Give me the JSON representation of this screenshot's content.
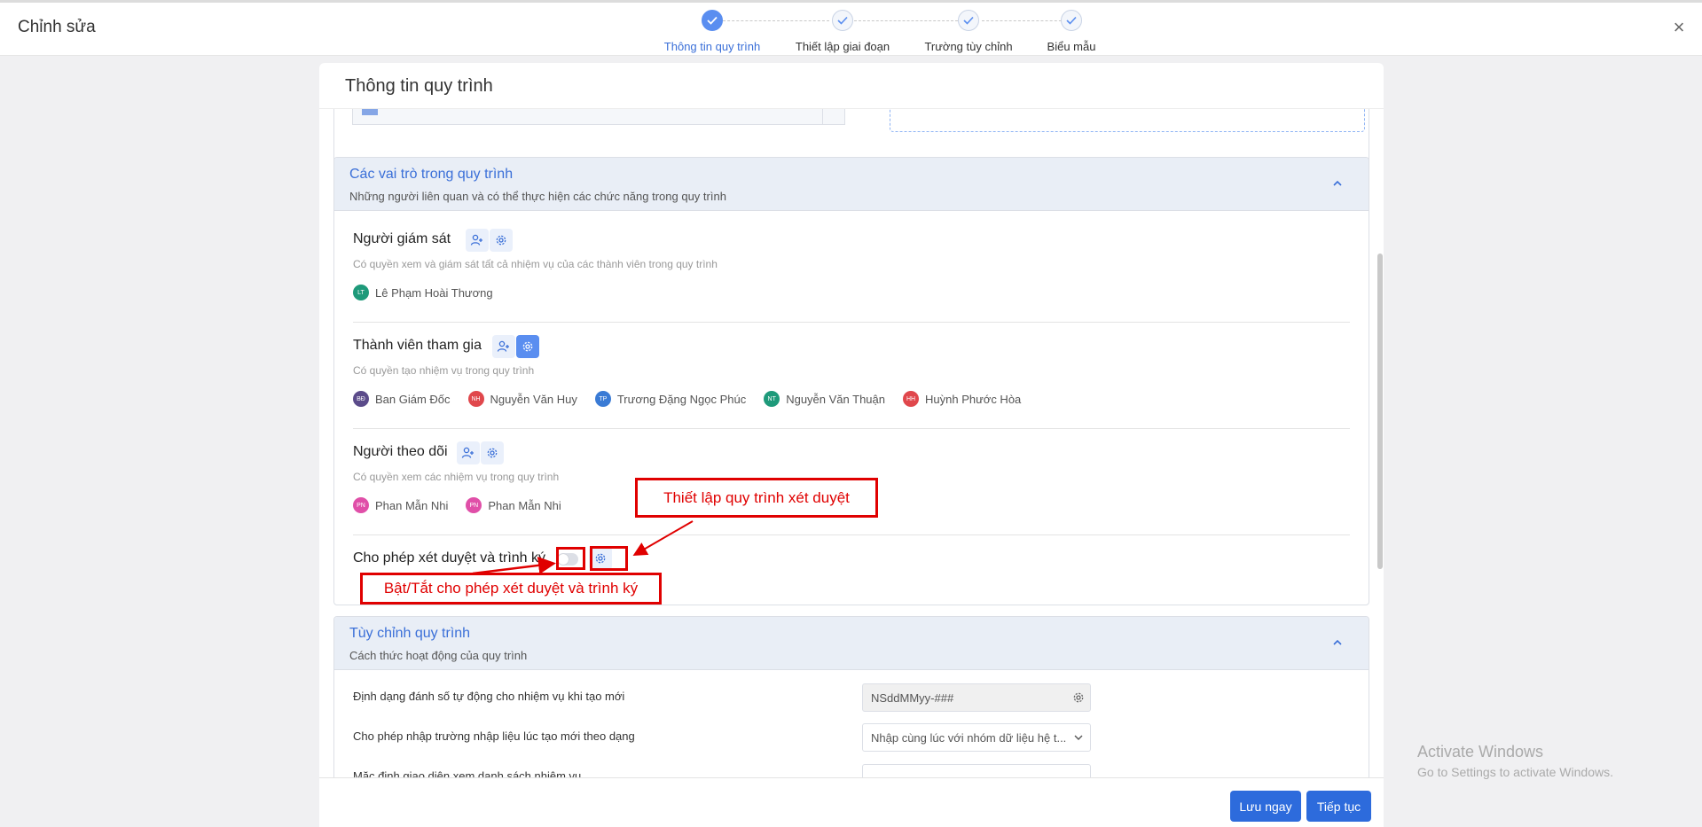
{
  "header": {
    "title": "Chỉnh sửa",
    "close": "×",
    "steps": [
      {
        "label": "Thông tin quy trình",
        "active": true
      },
      {
        "label": "Thiết lập giai đoạn",
        "active": false
      },
      {
        "label": "Trường tùy chỉnh",
        "active": false
      },
      {
        "label": "Biểu mẫu",
        "active": false
      }
    ]
  },
  "panel": {
    "title": "Thông tin quy trình"
  },
  "roles_section": {
    "title": "Các vai trò trong quy trình",
    "description": "Những người liên quan và có thể thực hiện các chức năng trong quy trình",
    "supervisor": {
      "name": "Người giám sát",
      "desc": "Có quyền xem và giám sát tất cả nhiệm vụ của các thành viên trong quy trình",
      "members": [
        {
          "initials": "LT",
          "name": "Lê Phạm Hoài Thương",
          "color": "#1e9a7a"
        }
      ]
    },
    "participants": {
      "name": "Thành viên tham gia",
      "desc": "Có quyền tạo nhiệm vụ trong quy trình",
      "members": [
        {
          "initials": "BĐ",
          "name": "Ban Giám Đốc",
          "color": "#5b4b8a"
        },
        {
          "initials": "NH",
          "name": "Nguyễn Văn Huy",
          "color": "#e0474c"
        },
        {
          "initials": "TP",
          "name": "Trương Đặng Ngọc Phúc",
          "color": "#3a7bd5"
        },
        {
          "initials": "NT",
          "name": "Nguyễn Văn Thuận",
          "color": "#1e9a7a"
        },
        {
          "initials": "HH",
          "name": "Huỳnh Phước Hòa",
          "color": "#e0474c"
        }
      ]
    },
    "followers": {
      "name": "Người theo dõi",
      "desc": "Có quyền xem các nhiệm vụ trong quy trình",
      "members": [
        {
          "initials": "PN",
          "name": "Phan Mẫn Nhi",
          "color": "#e04fa8"
        },
        {
          "initials": "PN",
          "name": "Phan Mẫn Nhi",
          "color": "#e04fa8"
        }
      ]
    },
    "approval": {
      "name": "Cho phép xét duyệt và trình ký",
      "enabled": false
    }
  },
  "annotations": {
    "settings_callout": "Thiết lập quy trình xét duyệt",
    "toggle_callout": "Bật/Tắt cho phép xét duyệt và trình ký"
  },
  "custom_section": {
    "title": "Tùy chỉnh quy trình",
    "description": "Cách thức hoạt động của quy trình",
    "rows": [
      {
        "label": "Định dạng đánh số tự động cho nhiệm vụ khi tạo mới",
        "value": "NSddMMyy-###"
      },
      {
        "label": "Cho phép nhập trường nhập liệu lúc tạo mới theo dạng",
        "value": "Nhập cùng lúc với nhóm dữ liệu hệ t..."
      },
      {
        "label": "Mặc định giao diện xem danh sách nhiệm vụ",
        "value": ""
      }
    ]
  },
  "footer": {
    "save_label": "Lưu ngay",
    "next_label": "Tiếp tục"
  },
  "watermark": {
    "line1": "Activate Windows",
    "line2": "Go to Settings to activate Windows."
  },
  "colors": {
    "primary": "#2d6bdc",
    "accent": "#3a6fd8",
    "annotation": "#e00000"
  }
}
